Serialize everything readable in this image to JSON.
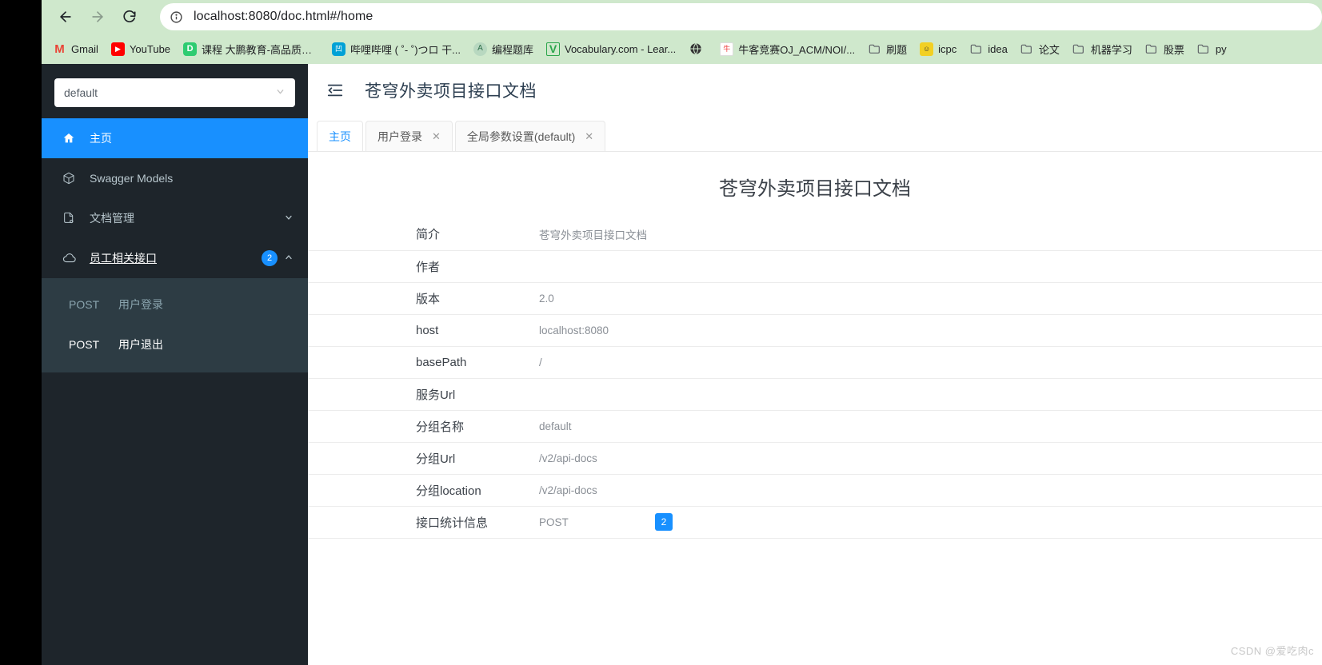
{
  "browser": {
    "back_label": "back-arrow",
    "forward_label": "forward-arrow",
    "reload_label": "reload",
    "site_info_label": "site-info",
    "url": "localhost:8080/doc.html#/home",
    "bookmarks": [
      {
        "label": "Gmail",
        "icon": "gmail-icon",
        "glyph": "M"
      },
      {
        "label": "YouTube",
        "icon": "youtube-icon",
        "glyph": "▶"
      },
      {
        "label": "课程 大鹏教育-高品质的...",
        "icon": "dapeng-icon",
        "glyph": "D"
      },
      {
        "label": "哔哩哔哩 ( ˚- ˚)つロ 干...",
        "icon": "bilibili-icon",
        "glyph": "凹"
      },
      {
        "label": "编程题库",
        "icon": "coding-icon",
        "glyph": "A"
      },
      {
        "label": "Vocabulary.com - Lear...",
        "icon": "vocabulary-icon",
        "glyph": "V"
      },
      {
        "label": "",
        "icon": "globe-icon",
        "glyph": "🌐"
      },
      {
        "label": "牛客竞赛OJ_ACM/NOI/...",
        "icon": "nowcoder-icon",
        "glyph": "牛"
      },
      {
        "label": "刷题",
        "icon": "folder-icon",
        "glyph": ""
      },
      {
        "label": "icpc",
        "icon": "icpc-icon",
        "glyph": "☺"
      },
      {
        "label": "idea",
        "icon": "folder-icon",
        "glyph": ""
      },
      {
        "label": "论文",
        "icon": "folder-icon",
        "glyph": ""
      },
      {
        "label": "机器学习",
        "icon": "folder-icon",
        "glyph": ""
      },
      {
        "label": "股票",
        "icon": "folder-icon",
        "glyph": ""
      },
      {
        "label": "py",
        "icon": "folder-icon",
        "glyph": ""
      }
    ]
  },
  "sidebar": {
    "group_select": {
      "value": "default",
      "placeholder": "default"
    },
    "items": [
      {
        "label": "主页",
        "icon": "home-icon",
        "active": true
      },
      {
        "label": "Swagger Models",
        "icon": "cube-icon",
        "active": false
      },
      {
        "label": "文档管理",
        "icon": "document-icon",
        "active": false,
        "arrow": "⌄"
      },
      {
        "label": "员工相关接口",
        "icon": "cloud-icon",
        "active": false,
        "badge": "2",
        "arrow": "⌃"
      }
    ],
    "submenu": [
      {
        "method": "POST",
        "label": "用户登录",
        "current": false
      },
      {
        "method": "POST",
        "label": "用户退出",
        "current": true
      }
    ]
  },
  "header": {
    "fold_icon": "menu-fold-icon",
    "title": "苍穹外卖项目接口文档"
  },
  "tabs": [
    {
      "label": "主页",
      "closable": false,
      "active": true
    },
    {
      "label": "用户登录",
      "closable": true,
      "active": false,
      "close": "✕"
    },
    {
      "label": "全局参数设置(default)",
      "closable": true,
      "active": false,
      "close": "✕"
    }
  ],
  "content": {
    "doc_title": "苍穹外卖项目接口文档",
    "rows": [
      {
        "key": "简介",
        "value": "苍穹外卖项目接口文档"
      },
      {
        "key": "作者",
        "value": ""
      },
      {
        "key": "版本",
        "value": "2.0"
      },
      {
        "key": "host",
        "value": "localhost:8080"
      },
      {
        "key": "basePath",
        "value": "/"
      },
      {
        "key": "服务Url",
        "value": ""
      },
      {
        "key": "分组名称",
        "value": "default"
      },
      {
        "key": "分组Url",
        "value": "/v2/api-docs"
      },
      {
        "key": "分组location",
        "value": "/v2/api-docs"
      }
    ],
    "stats": {
      "key": "接口统计信息",
      "method": "POST",
      "count": "2"
    }
  },
  "watermark": "CSDN @爱吃肉c",
  "colors": {
    "accent": "#1890ff",
    "sidebar_bg": "#1e252b",
    "submenu_bg": "#2d3c44",
    "chrome_bg": "#cfe8cc"
  }
}
